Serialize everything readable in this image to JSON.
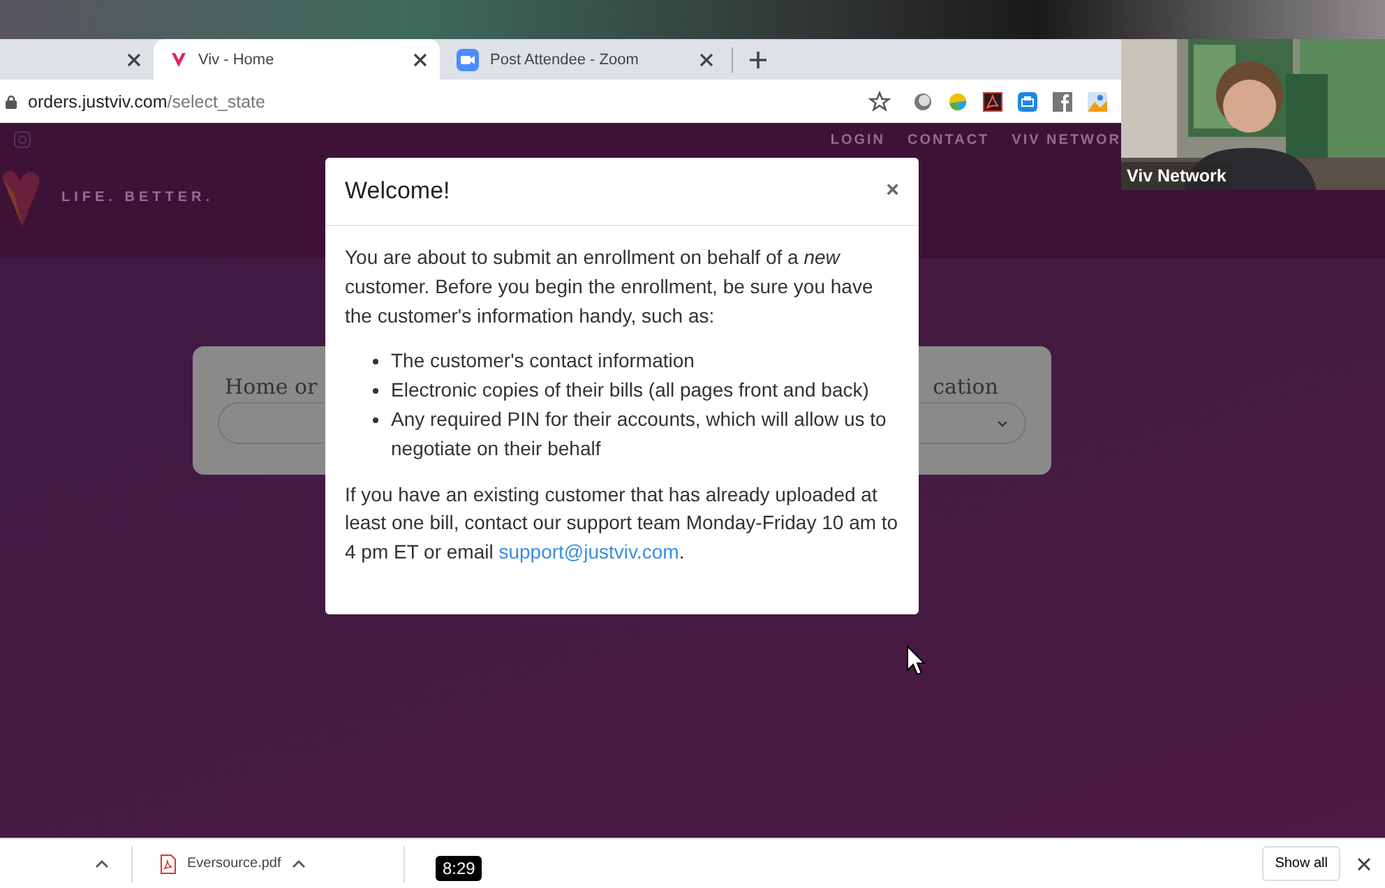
{
  "browser": {
    "tabs": [
      {
        "kind": "plain",
        "selected": false
      },
      {
        "kind": "viv",
        "title": "Viv - Home",
        "selected": true
      },
      {
        "kind": "zoom",
        "title": "Post Attendee - Zoom",
        "selected": false
      }
    ],
    "address": {
      "host": "orders.justviv.com",
      "path": "/select_state"
    }
  },
  "site": {
    "tagline": "LIFE. BETTER.",
    "nav": [
      "LOGIN",
      "CONTACT",
      "VIV NETWOR"
    ],
    "card_labels": [
      "Home or",
      "cation"
    ]
  },
  "modal": {
    "title": "Welcome!",
    "close": "×",
    "intro": "You are about to submit an enrollment on behalf of a *new* customer. Before you begin the enrollment, be sure you have the customer's information handy, such as:",
    "bullets": [
      "The customer's contact information",
      "Electronic copies of their bills (all pages front and back)",
      "Any required PIN for their accounts, which will allow us to negotiate on their behalf"
    ],
    "footer": "If you have an existing customer that has already uploaded at least one bill, contact our support team Monday-Friday 10 am to 4 pm ET or email ",
    "link": "support@justviv.com",
    "footer_end": "."
  },
  "video": {
    "name": "Viv Network"
  },
  "timer": "8:29",
  "downloads": {
    "items": [
      {
        "kind": "partial"
      },
      {
        "kind": "pdf",
        "name": "Eversource.pdf"
      }
    ],
    "show_all": "Show all"
  }
}
